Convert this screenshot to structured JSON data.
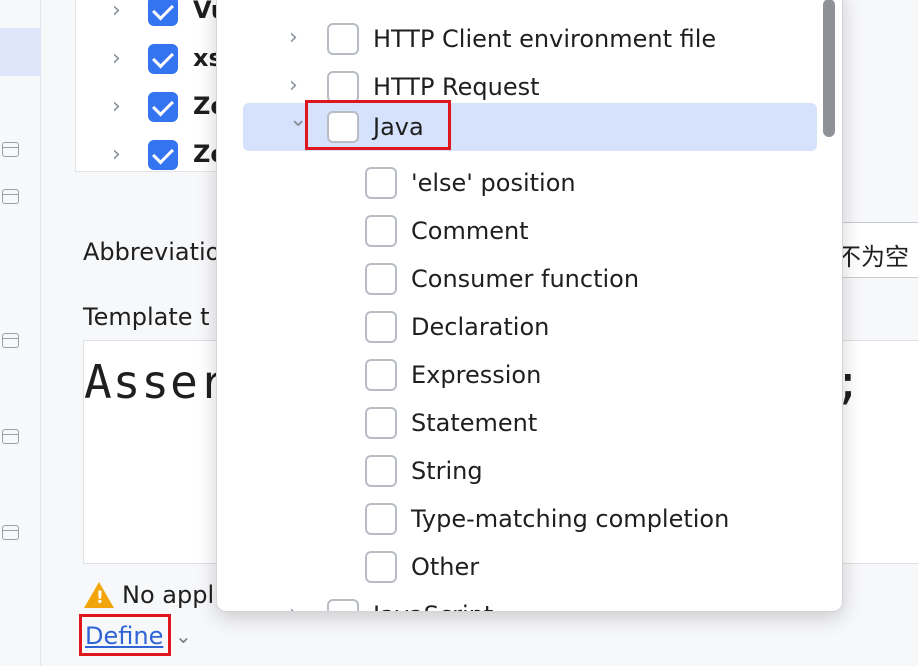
{
  "tree": {
    "items": [
      {
        "label": "Vu",
        "checked": true
      },
      {
        "label": "xs",
        "checked": true
      },
      {
        "label": "Ze",
        "checked": true
      },
      {
        "label": "Ze",
        "checked": true
      }
    ]
  },
  "form": {
    "abbreviation_label": "Abbreviatio",
    "abbreviation_value": "不为空",
    "template_label": "Template t",
    "template_code": "Asser",
    "template_code_end": ";"
  },
  "warning": {
    "text": "No appl"
  },
  "define": {
    "link": "Define"
  },
  "context_popup": {
    "items": [
      {
        "label": "HTTP Client environment file",
        "level": 1,
        "checked": false,
        "expanded": false
      },
      {
        "label": "HTTP Request",
        "level": 1,
        "checked": false,
        "expanded": false
      },
      {
        "label": "Java",
        "level": 1,
        "checked": false,
        "expanded": true,
        "selected": true
      },
      {
        "label": "'else' position",
        "level": 2,
        "checked": false
      },
      {
        "label": "Comment",
        "level": 2,
        "checked": false
      },
      {
        "label": "Consumer function",
        "level": 2,
        "checked": false
      },
      {
        "label": "Declaration",
        "level": 2,
        "checked": false
      },
      {
        "label": "Expression",
        "level": 2,
        "checked": false
      },
      {
        "label": "Statement",
        "level": 2,
        "checked": false
      },
      {
        "label": "String",
        "level": 2,
        "checked": false
      },
      {
        "label": "Type-matching completion",
        "level": 2,
        "checked": false
      },
      {
        "label": "Other",
        "level": 2,
        "checked": false
      },
      {
        "label": "JavaScript",
        "level": 1,
        "checked": false,
        "expanded": false
      }
    ]
  },
  "icons": {
    "chevron_right": "›",
    "chevron_down": "⌄",
    "warning": "!"
  },
  "colors": {
    "accent": "#3574f0",
    "link": "#2f64d6",
    "selection": "#d6e1fb",
    "highlight_box": "#e0161f",
    "warning": "#f2a50a"
  }
}
